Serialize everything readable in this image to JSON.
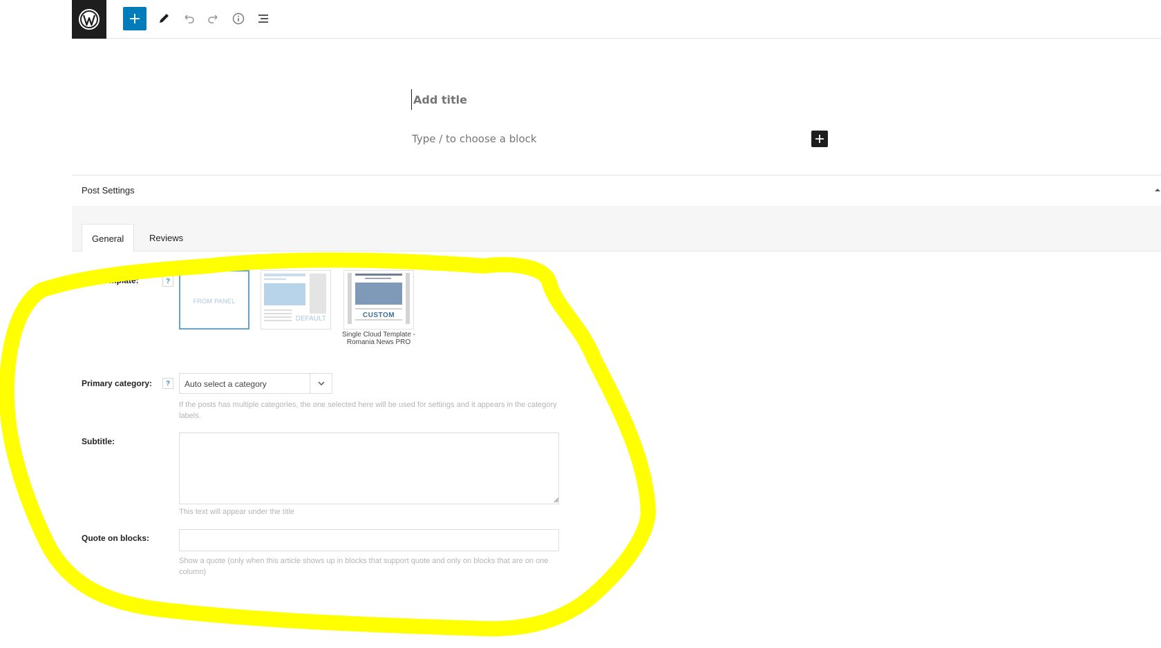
{
  "toolbar": {
    "logo_icon": "wordpress-logo-icon",
    "add_icon": "plus-icon",
    "edit_icon": "pencil-icon",
    "undo_icon": "undo-icon",
    "redo_icon": "redo-icon",
    "info_icon": "info-icon",
    "outline_icon": "list-view-icon"
  },
  "editor": {
    "title_placeholder": "Add title",
    "block_placeholder": "Type / to choose a block"
  },
  "metabox": {
    "title": "Post Settings",
    "tabs": [
      {
        "label": "General",
        "active": true
      },
      {
        "label": "Reviews",
        "active": false
      }
    ],
    "fields": {
      "post_template": {
        "label": "Post template:",
        "help": "?",
        "options": [
          {
            "label": "FROM PANEL",
            "selected": true
          },
          {
            "label": "DEFAULT",
            "selected": false
          },
          {
            "label": "CUSTOM",
            "selected": false
          }
        ],
        "custom_caption": "Single Cloud Template - Romania News PRO"
      },
      "primary_category": {
        "label": "Primary category:",
        "help": "?",
        "value": "Auto select a category",
        "hint": "If the posts has multiple categories, the one selected here will be used for settings and it appears in the category labels."
      },
      "subtitle": {
        "label": "Subtitle:",
        "value": "",
        "hint": "This text will appear under the title"
      },
      "quote_on_blocks": {
        "label": "Quote on blocks:",
        "value": "",
        "hint": "Show a quote (only when this article shows up in blocks that support quote and only on blocks that are on one column)"
      }
    }
  },
  "colors": {
    "accent": "#007cba",
    "dark": "#1e1e1e",
    "highlight": "#ffff00",
    "selected_border": "#5fa4d4"
  }
}
